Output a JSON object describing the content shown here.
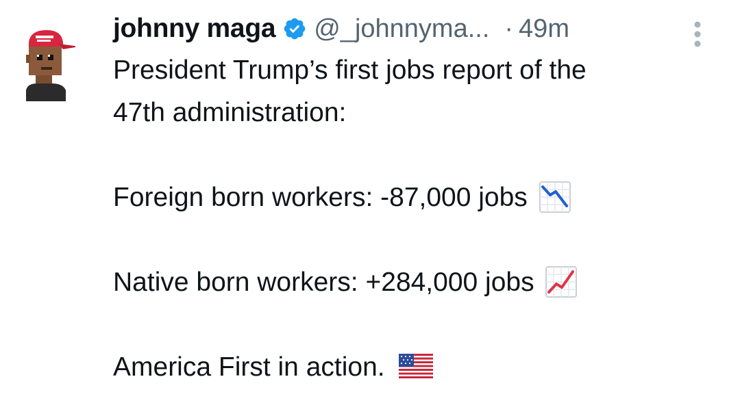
{
  "tweet": {
    "display_name": "johnny maga",
    "handle": "@_johnnyma...",
    "separator": "·",
    "time": "49m",
    "verified": true,
    "avatar_icon": "maga-hat-pixel-avatar-icon",
    "more_icon": "vertical-ellipsis-icon",
    "lines": {
      "l1": "President Trump’s first jobs report of the",
      "l2": "47th administration:",
      "foreign": "Foreign born workers: -87,000 jobs",
      "native": "Native born workers: +284,000 jobs",
      "closing": "America First in action."
    },
    "emojis": {
      "foreign": "chart-decreasing-icon",
      "native": "chart-increasing-icon",
      "closing": "us-flag-icon"
    }
  },
  "colors": {
    "text": "#0f1419",
    "secondary": "#536471",
    "verified_blue": "#1d9bf0",
    "hat_red": "#d7263d"
  }
}
